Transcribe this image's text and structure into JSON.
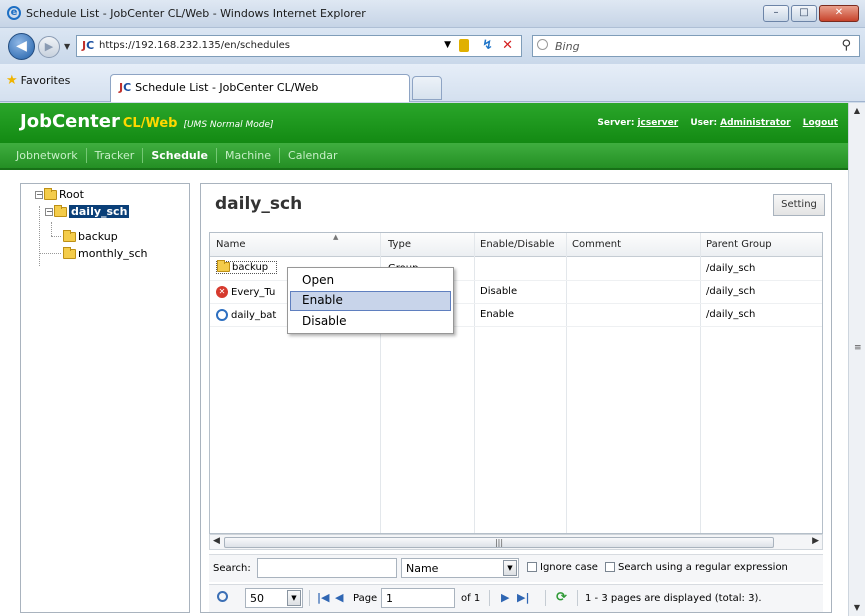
{
  "browser": {
    "title": "Schedule List - JobCenter CL/Web - Windows Internet Explorer",
    "url": "https://192.168.232.135/en/schedules",
    "search_placeholder": "Bing",
    "favorites_label": "Favorites",
    "tab_title": "Schedule List - JobCenter CL/Web",
    "site_icon_text": "JC"
  },
  "app": {
    "brand": "JobCenter",
    "brand_suffix": "CL/Web",
    "mode": "[UMS Normal Mode]",
    "server_label": "Server:",
    "server_name": "jcserver",
    "user_label": "User:",
    "user_name": "Administrator",
    "logout": "Logout",
    "menu": [
      "Jobnetwork",
      "Tracker",
      "Schedule",
      "Machine",
      "Calendar"
    ]
  },
  "tree": {
    "root": "Root",
    "daily": "daily_sch",
    "backup": "backup",
    "monthly": "monthly_sch"
  },
  "panel": {
    "title": "daily_sch",
    "setting": "Setting"
  },
  "grid": {
    "headers": [
      "Name",
      "Type",
      "Enable/Disable",
      "Comment",
      "Parent Group"
    ],
    "rows": [
      {
        "name": "backup",
        "type": "Group",
        "enable": "",
        "comment": "",
        "parent": "/daily_sch"
      },
      {
        "name": "Every_Tu",
        "type": "",
        "enable": "Disable",
        "comment": "",
        "parent": "/daily_sch"
      },
      {
        "name": "daily_bat",
        "type": "",
        "enable": "Enable",
        "comment": "",
        "parent": "/daily_sch"
      }
    ]
  },
  "search": {
    "label": "Search:",
    "field": "Name",
    "ignore_case": "Ignore case",
    "regex": "Search using a regular expression"
  },
  "pager": {
    "page_size": "50",
    "page_label": "Page",
    "page_value": "1",
    "of_label": "of 1",
    "info": "1 - 3 pages are displayed (total: 3)."
  },
  "context_menu": {
    "items": [
      "Open",
      "Enable",
      "Disable"
    ],
    "highlighted": "Enable"
  }
}
